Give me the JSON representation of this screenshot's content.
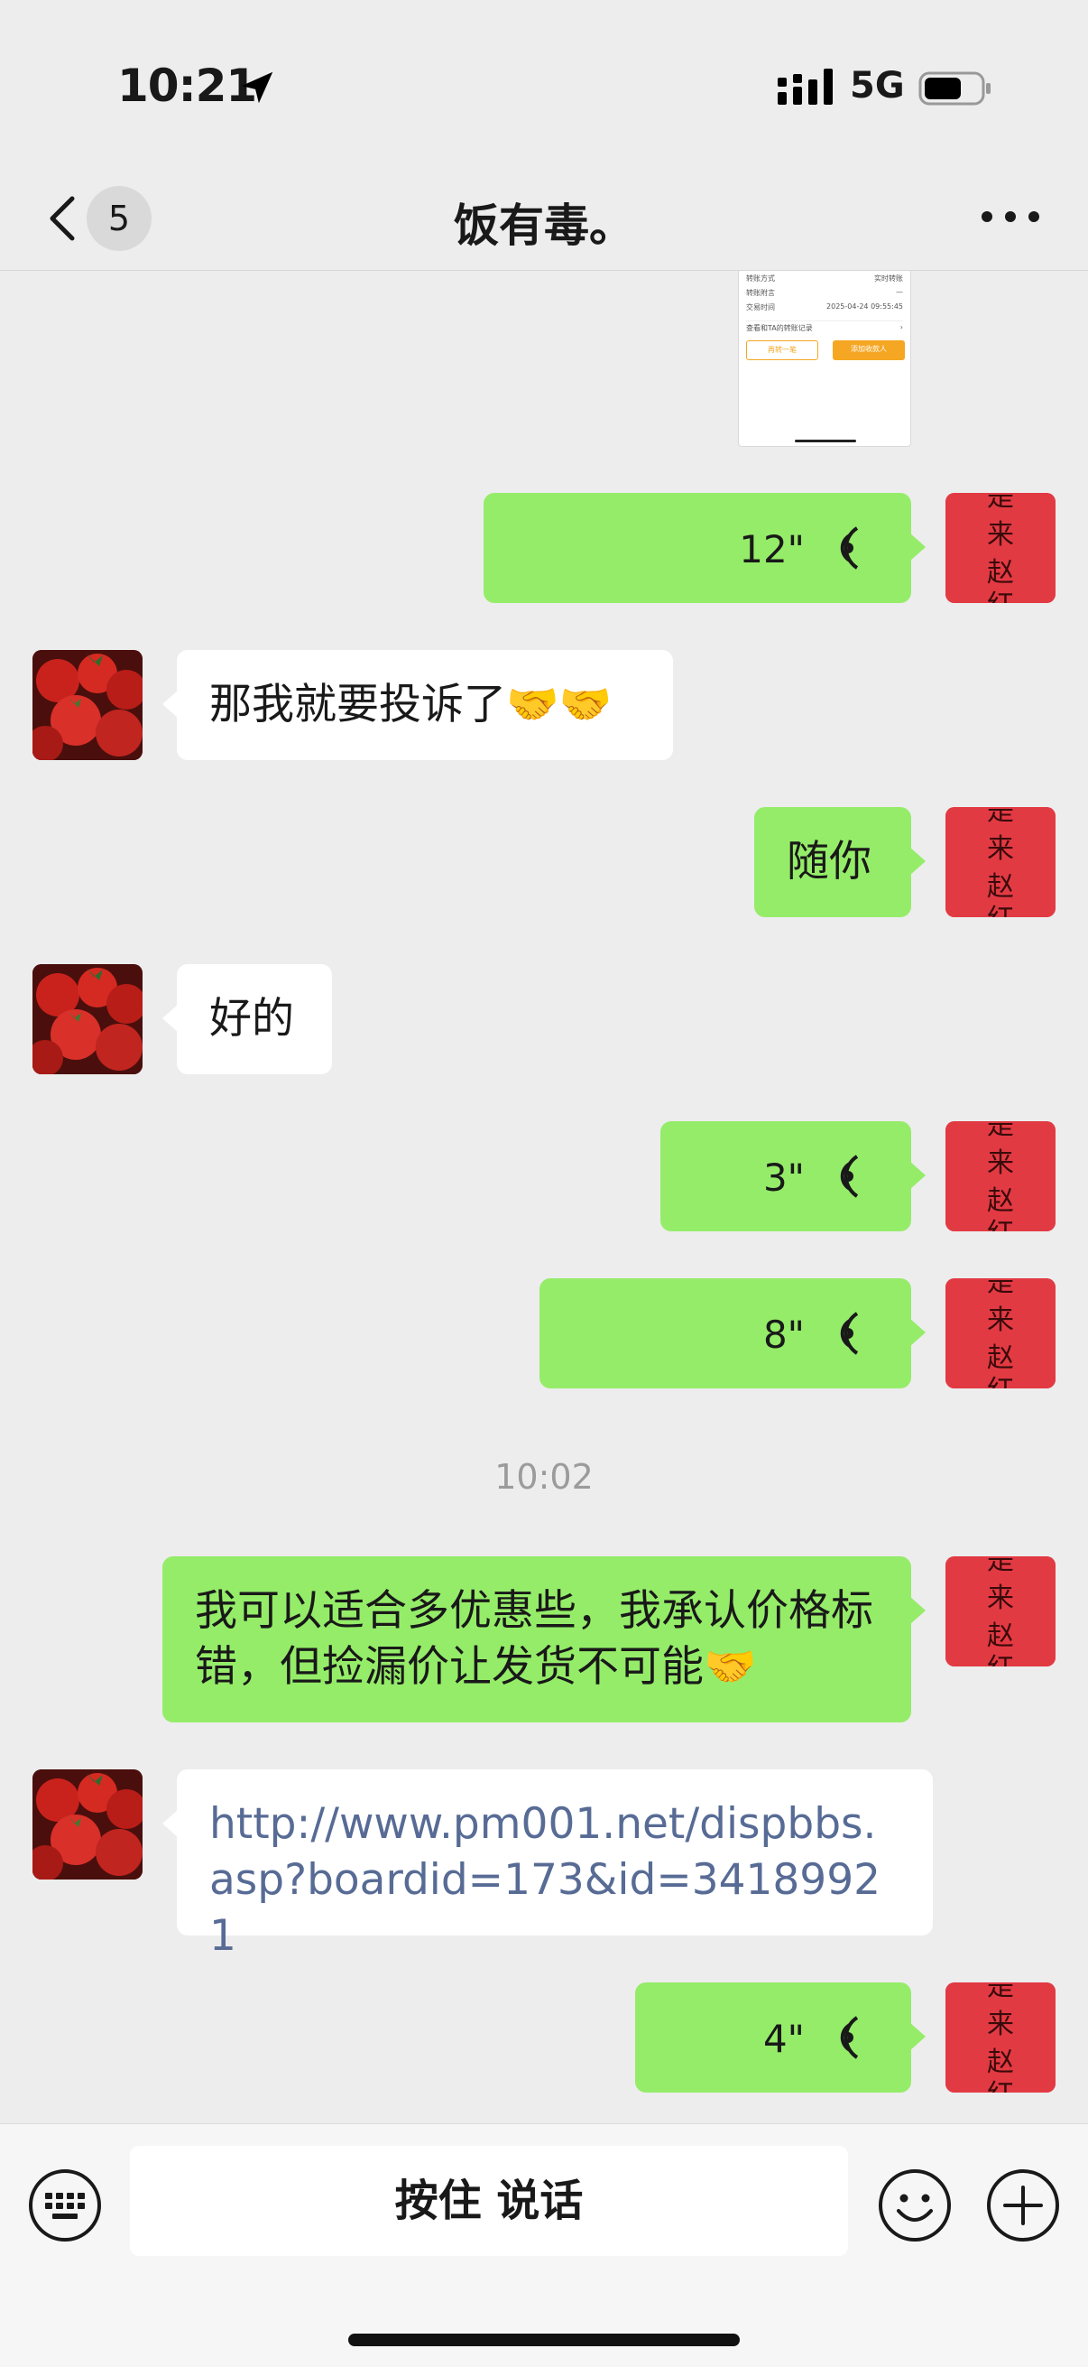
{
  "status_bar": {
    "time": "10:21",
    "network": "5G"
  },
  "nav": {
    "unread_count": "5",
    "title": "饭有毒。"
  },
  "messages": [
    {
      "voice_duration": "12\""
    },
    {
      "text": "那我就要投诉了🤝🤝"
    },
    {
      "text": "随你"
    },
    {
      "text": "好的"
    },
    {
      "voice_duration": "3\""
    },
    {
      "voice_duration": "8\""
    },
    {
      "time": "10:02"
    },
    {
      "text": "我可以适合多优惠些，我承认价格标错，但捡漏价让发货不可能🤝"
    },
    {
      "link": "http://www.pm001.net/dispbbs.asp?boardid=173&id=34189921"
    },
    {
      "voice_duration": "4\""
    }
  ],
  "transfer_image": {
    "rows": [
      {
        "label": "转账方式",
        "value": "实时转账"
      },
      {
        "label": "转账附言",
        "value": "—"
      },
      {
        "label": "交易时间",
        "value": "2025-04-24 09:55:45"
      }
    ],
    "records_link": "查看和TA的转账记录",
    "button_again": "再转一笔",
    "button_contact": "添加收款人"
  },
  "input": {
    "hold_to_talk": "按住 说话"
  }
}
